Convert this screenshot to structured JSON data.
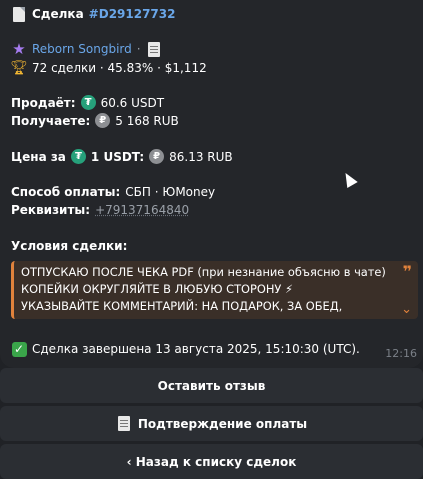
{
  "header": {
    "icon": "document-icon",
    "label": "Сделка",
    "deal_id": "#D29127732"
  },
  "user": {
    "icon": "star-icon",
    "name": "Reborn Songbird",
    "separator": "·",
    "edit_icon": "memo-icon"
  },
  "stats": {
    "icon": "trophy-icon",
    "text": "72 сделки · 45.83% · $1,112"
  },
  "sell": {
    "label": "Продаёт:",
    "icon": "tether-icon",
    "value": "60.6 USDT"
  },
  "receive": {
    "label": "Получаете:",
    "icon": "ruble-coin-icon",
    "value": "5 168 RUB"
  },
  "price": {
    "label": "Цена за",
    "icon": "tether-icon",
    "unit": "1 USDT:",
    "icon2": "ruble-coin-icon",
    "value": "86.13 RUB"
  },
  "payment": {
    "label": "Способ оплаты:",
    "value": "СБП · ЮMoney"
  },
  "requisites": {
    "label": "Реквизиты:",
    "value": "+79137164840"
  },
  "conditions": {
    "label": "Условия сделки:",
    "lines": [
      "ОТПУСКАЮ ПОСЛЕ ЧЕКА PDF (при незнание объясню в чате)",
      "КОПЕЙКИ ОКРУГЛЯЙТЕ В ЛЮБУЮ СТОРОНУ ⚡",
      "УКАЗЫВАЙТЕ КОММЕНТАРИЙ: НА ПОДАРОК, ЗА ОБЕД,"
    ],
    "quote_mark": "❞",
    "expand_icon": "chevron-down-icon",
    "accent": "#e0823c"
  },
  "status": {
    "icon": "check-mark-icon",
    "text": "Сделка завершена 13 августа 2025, 15:10:30 (UTC)."
  },
  "time": "12:16",
  "buttons": {
    "review": "Оставить отзыв",
    "confirm": "Подтверждение оплаты",
    "confirm_icon": "receipt-icon",
    "back": "‹ Назад к списку сделок"
  },
  "colors": {
    "background": "#202226",
    "bubble": "#24262a",
    "link": "#6aa6e8",
    "tether": "#26a17b",
    "button": "#2b2e33"
  }
}
